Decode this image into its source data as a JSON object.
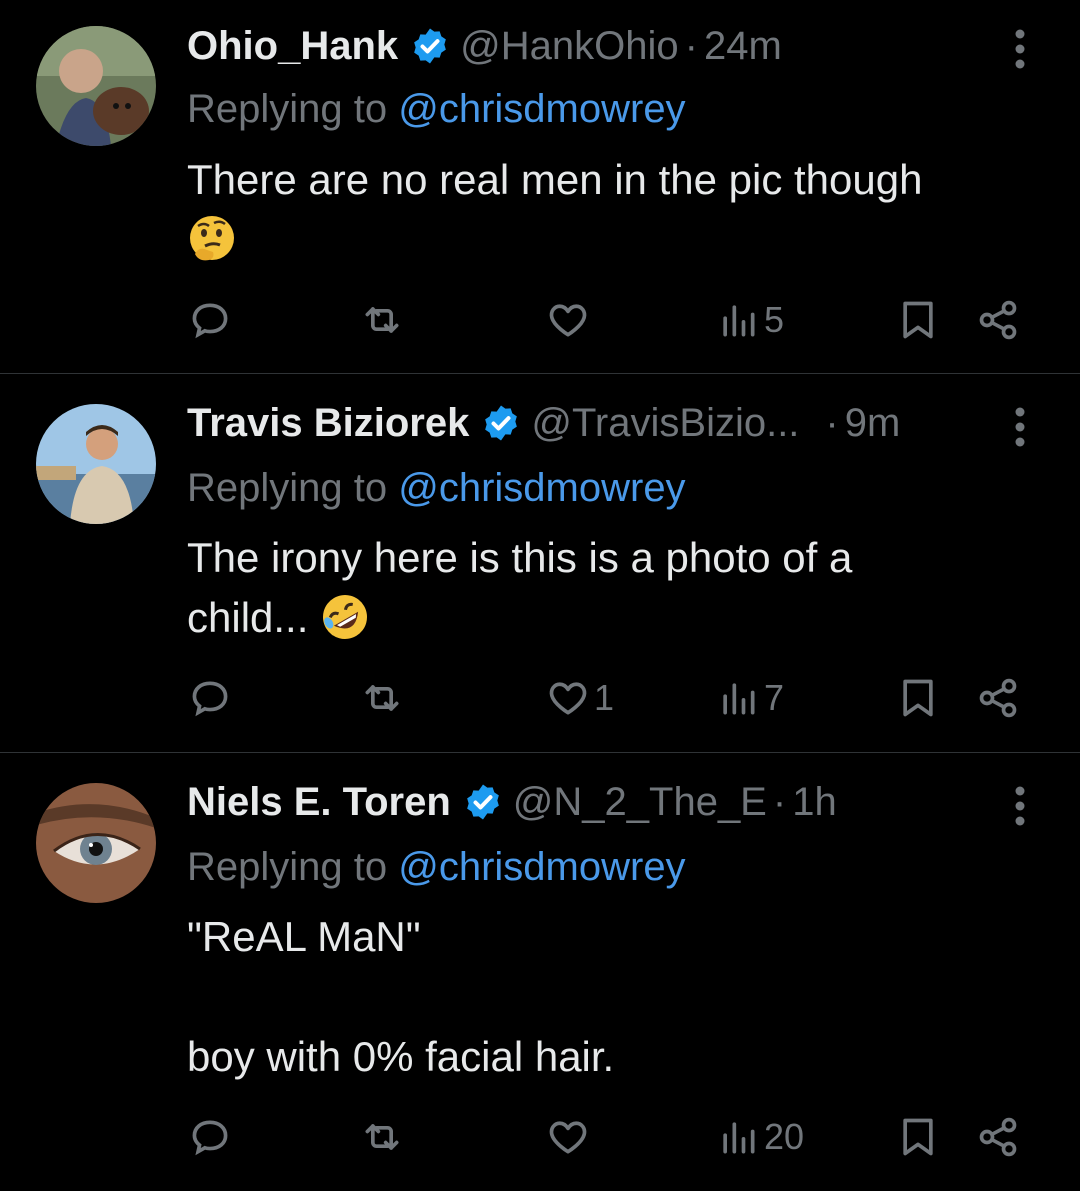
{
  "tweets": [
    {
      "name": "Ohio_Hank",
      "handle": "@HankOhio",
      "dot": "·",
      "time": "24m",
      "replying_prefix": "Replying to ",
      "replying_handle": "@chrisdmowrey",
      "body_line1": "There are no real men in the pic though",
      "body_line2": "",
      "emoji": "thinking-face",
      "counts": {
        "reply": "",
        "retweet": "",
        "like": "",
        "views": "5"
      }
    },
    {
      "name": "Travis Biziorek",
      "handle": "@TravisBizio...",
      "dot": "·",
      "time": "9m",
      "replying_prefix": "Replying to ",
      "replying_handle": "@chrisdmowrey",
      "body_line1": "The irony here is this is a photo of a",
      "body_line2": "child...",
      "emoji": "rolling-on-floor-laughing",
      "counts": {
        "reply": "",
        "retweet": "",
        "like": "1",
        "views": "7"
      }
    },
    {
      "name": "Niels E. Toren",
      "handle": "@N_2_The_E",
      "dot": "·",
      "time": "1h",
      "replying_prefix": "Replying to ",
      "replying_handle": "@chrisdmowrey",
      "body_line1": "\"ReAL MaN\"",
      "body_line2": "boy with 0% facial hair.",
      "emoji": "",
      "counts": {
        "reply": "",
        "retweet": "",
        "like": "",
        "views": "20"
      }
    }
  ],
  "colors": {
    "background": "#000000",
    "text": "#e7e9ea",
    "muted": "#71767b",
    "link": "#4a99e9",
    "verified": "#1d9bf0"
  },
  "icons": [
    "verified-badge-icon",
    "more-icon",
    "reply-icon",
    "retweet-icon",
    "like-icon",
    "views-icon",
    "bookmark-icon",
    "share-icon"
  ]
}
